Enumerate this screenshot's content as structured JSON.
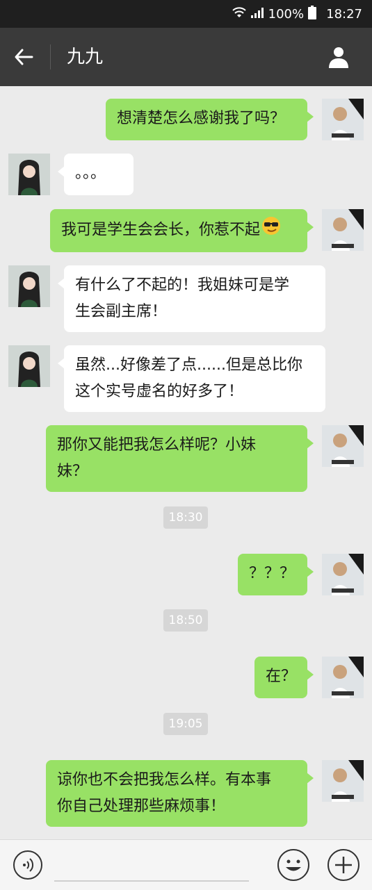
{
  "status": {
    "battery": "100%",
    "time": "18:27"
  },
  "header": {
    "title": "九九"
  },
  "messages": [
    {
      "side": "me",
      "text": "想清楚怎么感谢我了吗？"
    },
    {
      "side": "them",
      "text": "。。。"
    },
    {
      "side": "me",
      "text": "我可是学生会会长，你惹不起",
      "emoji": "sunglasses-smile"
    },
    {
      "side": "them",
      "text": "有什么了不起的！我姐妹可是学\n生会副主席！"
    },
    {
      "side": "them",
      "text": "虽然...好像差了点......但是总比你\n这个实号虚名的好多了！"
    },
    {
      "side": "me",
      "text": "那你又能把我怎么样呢？小妹\n妹？"
    },
    {
      "side": "time",
      "text": "18:30"
    },
    {
      "side": "me",
      "text": "？？？"
    },
    {
      "side": "time",
      "text": "18:50"
    },
    {
      "side": "me",
      "text": "在？"
    },
    {
      "side": "time",
      "text": "19:05"
    },
    {
      "side": "me",
      "text": "谅你也不会把我怎么样。有本事\n你自己处理那些麻烦事！"
    }
  ],
  "colors": {
    "my_bubble": "#98e165",
    "their_bubble": "#ffffff",
    "chat_bg": "#ebebeb",
    "nav_bg": "#3a3a3a"
  },
  "icons": {
    "back": "arrow-left-icon",
    "profile": "person-icon",
    "voice": "voice-icon",
    "emoji": "smiley-icon",
    "plus": "plus-icon"
  }
}
